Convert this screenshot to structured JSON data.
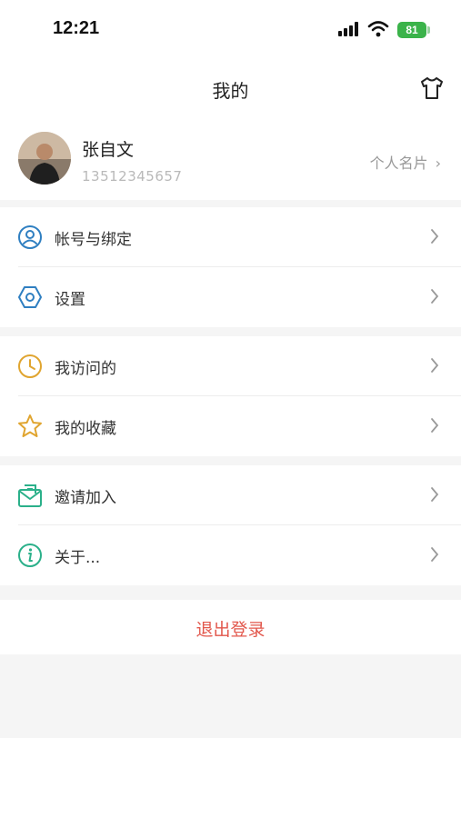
{
  "status_bar": {
    "time": "12:21",
    "battery": "81"
  },
  "header": {
    "title": "我的",
    "icon": "shirt-icon"
  },
  "profile": {
    "name": "张自文",
    "phone": "13512345657",
    "card_label": "个人名片",
    "chevron": "›"
  },
  "menu": [
    {
      "label": "帐号与绑定",
      "icon": "user-circle-icon",
      "color": "#2f7fc1"
    },
    {
      "label": "设置",
      "icon": "hex-settings-icon",
      "color": "#2f7fc1"
    },
    {
      "label": "我访问的",
      "icon": "clock-icon",
      "color": "#e0a530"
    },
    {
      "label": "我的收藏",
      "icon": "star-icon",
      "color": "#e0a530"
    },
    {
      "label": "邀请加入",
      "icon": "envelope-icon",
      "color": "#2bb08a"
    },
    {
      "label": "关于...",
      "icon": "info-icon",
      "color": "#2bb08a"
    }
  ],
  "logout": {
    "label": "退出登录",
    "color": "#e2574c"
  }
}
